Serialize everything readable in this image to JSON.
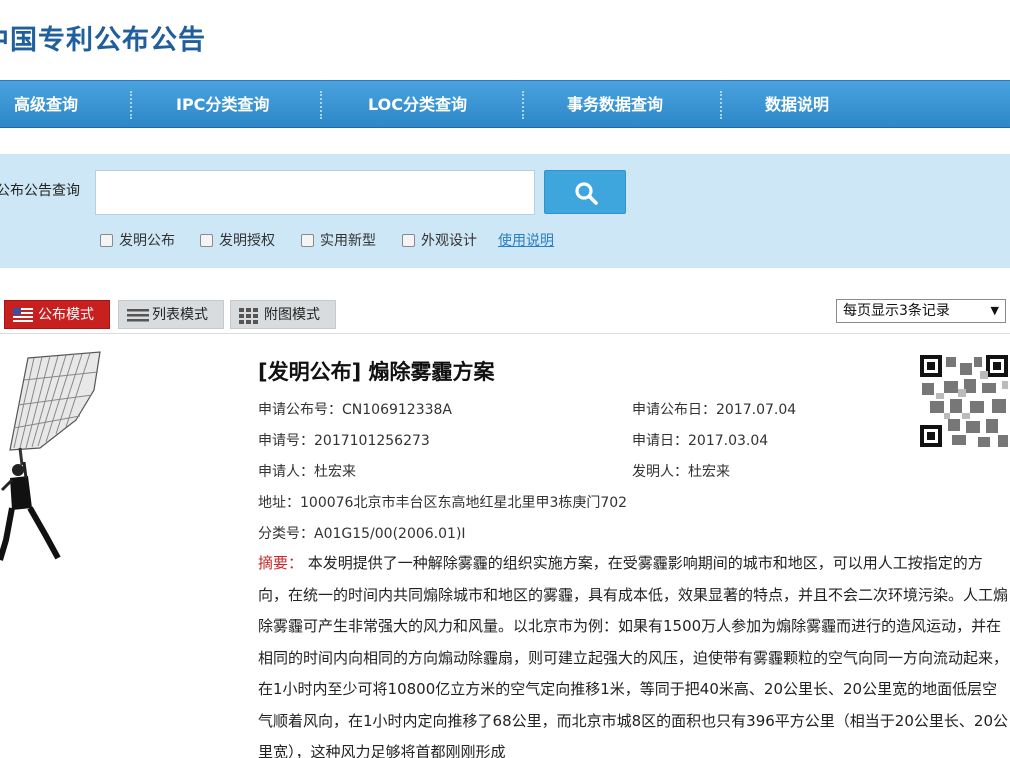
{
  "site": {
    "title": "中国专利公布公告"
  },
  "nav": {
    "items": [
      {
        "label": "高级查询"
      },
      {
        "label": "IPC分类查询"
      },
      {
        "label": "LOC分类查询"
      },
      {
        "label": "事务数据查询"
      },
      {
        "label": "数据说明"
      }
    ]
  },
  "search": {
    "label": "公布公告查询",
    "value": "",
    "placeholder": "",
    "button_icon": "search-icon",
    "filters": [
      {
        "label": "发明公布",
        "checked": false
      },
      {
        "label": "发明授权",
        "checked": false
      },
      {
        "label": "实用新型",
        "checked": false
      },
      {
        "label": "外观设计",
        "checked": false
      }
    ],
    "help_link": "使用说明"
  },
  "view_modes": {
    "items": [
      {
        "label": "公布模式",
        "icon": "flag-icon",
        "active": true
      },
      {
        "label": "列表模式",
        "icon": "list-icon",
        "active": false
      },
      {
        "label": "附图模式",
        "icon": "grid-icon",
        "active": false
      }
    ],
    "page_size": "每页显示3条记录"
  },
  "result": {
    "title": "[发明公布] 煽除雾霾方案",
    "pub_no_label": "申请公布号：",
    "pub_no": "CN106912338A",
    "pub_date_label": "申请公布日：",
    "pub_date": "2017.07.04",
    "app_no_label": "申请号：",
    "app_no": "2017101256273",
    "app_date_label": "申请日：",
    "app_date": "2017.03.04",
    "applicant_label": "申请人：",
    "applicant": "杜宏来",
    "inventor_label": "发明人：",
    "inventor": "杜宏来",
    "address_label": "地址：",
    "address": "100076北京市丰台区东高地红星北里甲3栋庚门702",
    "class_label": "分类号：",
    "class_no": "A01G15/00(2006.01)I",
    "abstract_label": "摘要：",
    "abstract": "本发明提供了一种解除雾霾的组织实施方案，在受雾霾影响期间的城市和地区，可以用人工按指定的方向，在统一的时间内共同煽除城市和地区的雾霾，具有成本低，效果显著的特点，并且不会二次环境污染。人工煽除雾霾可产生非常强大的风力和风量。以北京市为例：如果有1500万人参加为煽除雾霾而进行的造风运动，并在相同的时间内向相同的方向煽动除霾扇，则可建立起强大的风压，迫使带有雾霾颗粒的空气向同一方向流动起来，在1小时内至少可将10800亿立方米的空气定向推移1米，等同于把40米高、20公里长、20公里宽的地面低层空气顺着风向，在1小时内定向推移了68公里，而北京市城8区的面积也只有396平方公里（相当于20公里长、20公里宽），这种风力足够将首都刚刚形成"
  }
}
